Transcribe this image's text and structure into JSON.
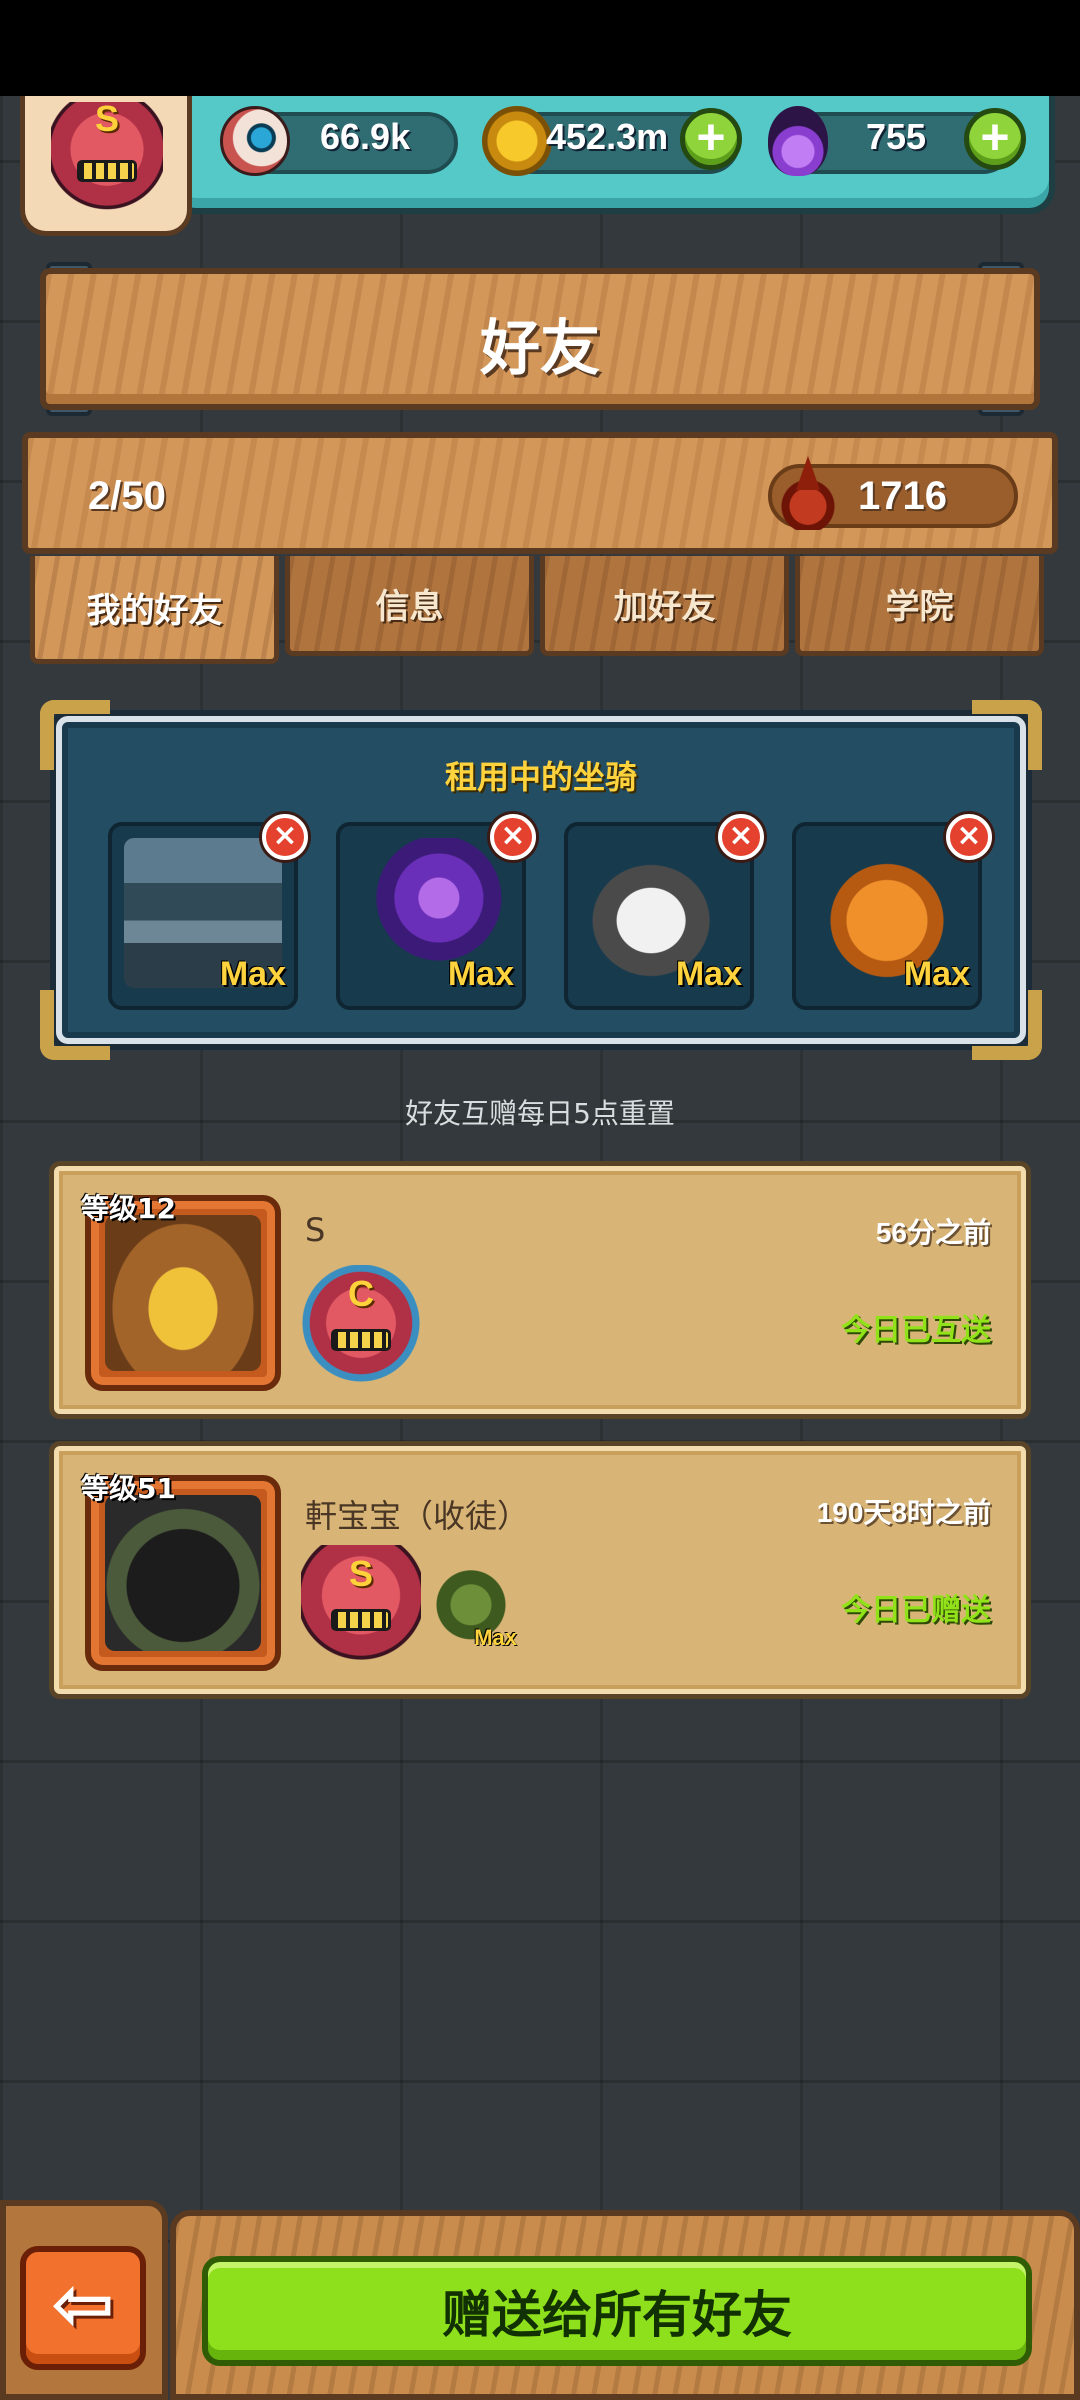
{
  "header": {
    "rank_letter": "S",
    "eyes": "66.9k",
    "coins": "452.3m",
    "potions": "755"
  },
  "page_title": "好友",
  "counters": {
    "friend_count": "2/50",
    "blood_points": "1716"
  },
  "tabs": [
    {
      "label": "我的好友",
      "active": true
    },
    {
      "label": "信息",
      "active": false
    },
    {
      "label": "加好友",
      "active": false
    },
    {
      "label": "学院",
      "active": false
    }
  ],
  "rented_mounts": {
    "title": "租用中的坐骑",
    "items": [
      {
        "label": "Max",
        "icon": "mech-tank-mount"
      },
      {
        "label": "Max",
        "icon": "purple-rose-mount"
      },
      {
        "label": "Max",
        "icon": "husky-dog-mount"
      },
      {
        "label": "Max",
        "icon": "pumpkin-robot-mount"
      }
    ]
  },
  "reset_note": "好友互赠每日5点重置",
  "friends": [
    {
      "level": "等级12",
      "name": "S",
      "last_seen": "56分之前",
      "status": "今日已互送",
      "rank_letter": "C",
      "avatar": "yak-monster-avatar"
    },
    {
      "level": "等级51",
      "name": "軒宝宝（收徒）",
      "last_seen": "190天8时之前",
      "status": "今日已赠送",
      "rank_letter": "S",
      "mount_label": "Max",
      "avatar": "black-soldier-avatar"
    }
  ],
  "bottom": {
    "gift_all_label": "赠送给所有好友",
    "back_symbol": "⇦"
  },
  "colors": {
    "accent_green": "#8fe01c",
    "wood": "#d4975a",
    "teal": "#55c8c8",
    "gold_text": "#ffd33d"
  }
}
